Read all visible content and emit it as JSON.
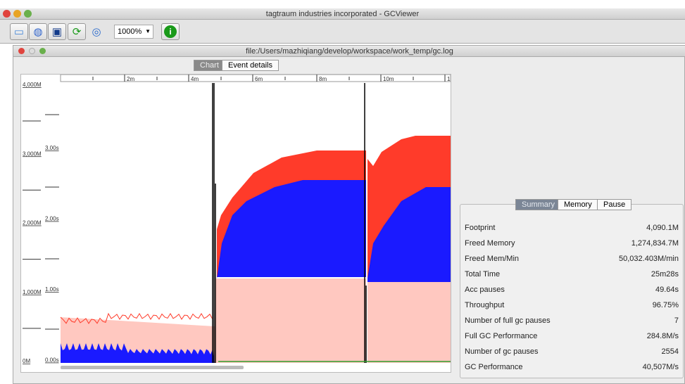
{
  "app": {
    "title": "tagtraum industries incorporated - GCViewer"
  },
  "toolbar": {
    "buttons": [
      {
        "icon": "open-file-icon"
      },
      {
        "icon": "open-url-icon"
      },
      {
        "icon": "save-icon"
      },
      {
        "icon": "refresh-icon"
      },
      {
        "icon": "watch-icon"
      },
      {
        "icon": "info-icon"
      }
    ],
    "zoom": "1000%"
  },
  "document": {
    "title": "file:/Users/mazhiqiang/develop/workspace/work_temp/gc.log",
    "tabs": [
      {
        "label": "Chart",
        "selected": true
      },
      {
        "label": "Event details",
        "selected": false
      }
    ]
  },
  "chart": {
    "memory_ticks": [
      "4,000M",
      "3,000M",
      "2,000M",
      "1,000M",
      "0M"
    ],
    "pause_ticks": [
      "3.00s",
      "2.00s",
      "1.00s",
      "0.00s"
    ],
    "time_ticks": [
      "2m",
      "4m",
      "6m",
      "8m",
      "10m",
      "1"
    ],
    "colors": {
      "total_heap": "#ffc8c0",
      "used_heap": "#ff3b2a",
      "young": "#1a1aff",
      "full_gc": "#000000",
      "gc_line": "#2e9e2e"
    }
  },
  "summary": {
    "tabs": [
      {
        "label": "Summary",
        "selected": true
      },
      {
        "label": "Memory",
        "selected": false
      },
      {
        "label": "Pause",
        "selected": false
      }
    ],
    "rows": [
      {
        "label": "Footprint",
        "value": "4,090.1M"
      },
      {
        "label": "Freed Memory",
        "value": "1,274,834.7M"
      },
      {
        "label": "Freed Mem/Min",
        "value": "50,032.403M/min"
      },
      {
        "label": "Total Time",
        "value": "25m28s"
      },
      {
        "label": "Acc pauses",
        "value": "49.64s"
      },
      {
        "label": "Throughput",
        "value": "96.75%"
      },
      {
        "label": "Number of full gc pauses",
        "value": "7"
      },
      {
        "label": "Full GC Performance",
        "value": "284.8M/s"
      },
      {
        "label": "Number of gc pauses",
        "value": "2554"
      },
      {
        "label": "GC Performance",
        "value": "40,507M/s"
      }
    ]
  }
}
